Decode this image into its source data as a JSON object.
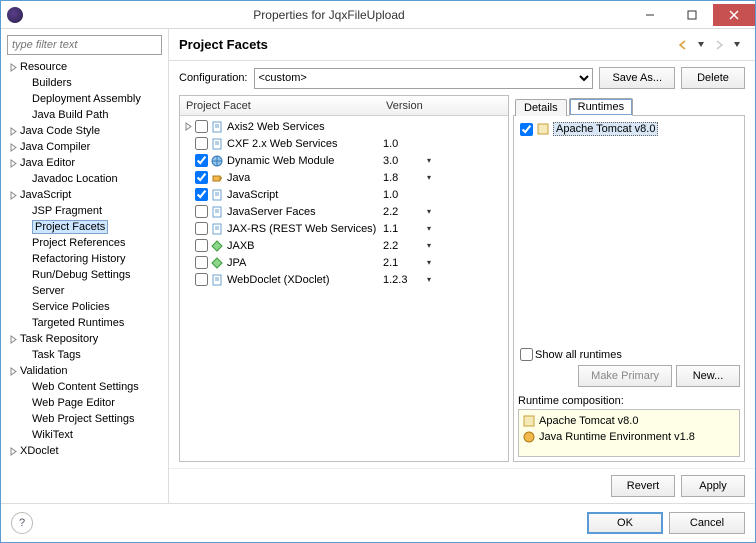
{
  "window": {
    "title": "Properties for JqxFileUpload"
  },
  "sidebar": {
    "filter_placeholder": "type filter text",
    "items": [
      {
        "label": "Resource",
        "level": 0,
        "exp": true
      },
      {
        "label": "Builders",
        "level": 1
      },
      {
        "label": "Deployment Assembly",
        "level": 1
      },
      {
        "label": "Java Build Path",
        "level": 1
      },
      {
        "label": "Java Code Style",
        "level": 0,
        "exp": true
      },
      {
        "label": "Java Compiler",
        "level": 0,
        "exp": true
      },
      {
        "label": "Java Editor",
        "level": 0,
        "exp": true
      },
      {
        "label": "Javadoc Location",
        "level": 1
      },
      {
        "label": "JavaScript",
        "level": 0,
        "exp": true
      },
      {
        "label": "JSP Fragment",
        "level": 1
      },
      {
        "label": "Project Facets",
        "level": 1,
        "selected": true
      },
      {
        "label": "Project References",
        "level": 1
      },
      {
        "label": "Refactoring History",
        "level": 1
      },
      {
        "label": "Run/Debug Settings",
        "level": 1
      },
      {
        "label": "Server",
        "level": 1
      },
      {
        "label": "Service Policies",
        "level": 1
      },
      {
        "label": "Targeted Runtimes",
        "level": 1
      },
      {
        "label": "Task Repository",
        "level": 0,
        "exp": true
      },
      {
        "label": "Task Tags",
        "level": 1
      },
      {
        "label": "Validation",
        "level": 0,
        "exp": true
      },
      {
        "label": "Web Content Settings",
        "level": 1
      },
      {
        "label": "Web Page Editor",
        "level": 1
      },
      {
        "label": "Web Project Settings",
        "level": 1
      },
      {
        "label": "WikiText",
        "level": 1
      },
      {
        "label": "XDoclet",
        "level": 0,
        "exp": true
      }
    ]
  },
  "main": {
    "heading": "Project Facets",
    "config_label": "Configuration:",
    "config_value": "<custom>",
    "save_as": "Save As...",
    "delete": "Delete",
    "columns": {
      "facet": "Project Facet",
      "version": "Version"
    },
    "facets": [
      {
        "name": "Axis2 Web Services",
        "version": "",
        "checked": false,
        "icon": "doc",
        "exp": true,
        "dd": false
      },
      {
        "name": "CXF 2.x Web Services",
        "version": "1.0",
        "checked": false,
        "icon": "doc",
        "dd": false
      },
      {
        "name": "Dynamic Web Module",
        "version": "3.0",
        "checked": true,
        "icon": "globe",
        "dd": true
      },
      {
        "name": "Java",
        "version": "1.8",
        "checked": true,
        "icon": "java",
        "dd": true
      },
      {
        "name": "JavaScript",
        "version": "1.0",
        "checked": true,
        "icon": "doc",
        "dd": false
      },
      {
        "name": "JavaServer Faces",
        "version": "2.2",
        "checked": false,
        "icon": "doc",
        "dd": true
      },
      {
        "name": "JAX-RS (REST Web Services)",
        "version": "1.1",
        "checked": false,
        "icon": "doc",
        "dd": true
      },
      {
        "name": "JAXB",
        "version": "2.2",
        "checked": false,
        "icon": "diamond",
        "dd": true
      },
      {
        "name": "JPA",
        "version": "2.1",
        "checked": false,
        "icon": "diamond",
        "dd": true
      },
      {
        "name": "WebDoclet (XDoclet)",
        "version": "1.2.3",
        "checked": false,
        "icon": "doc",
        "dd": true
      }
    ],
    "tabs": {
      "details": "Details",
      "runtimes": "Runtimes"
    },
    "runtime_item": "Apache Tomcat v8.0",
    "show_all": "Show all runtimes",
    "make_primary": "Make Primary",
    "new": "New...",
    "rcomp_label": "Runtime composition:",
    "rcomp": [
      {
        "icon": "tomcat",
        "label": "Apache Tomcat v8.0"
      },
      {
        "icon": "java",
        "label": "Java Runtime Environment v1.8"
      }
    ],
    "revert": "Revert",
    "apply": "Apply",
    "ok": "OK",
    "cancel": "Cancel"
  }
}
